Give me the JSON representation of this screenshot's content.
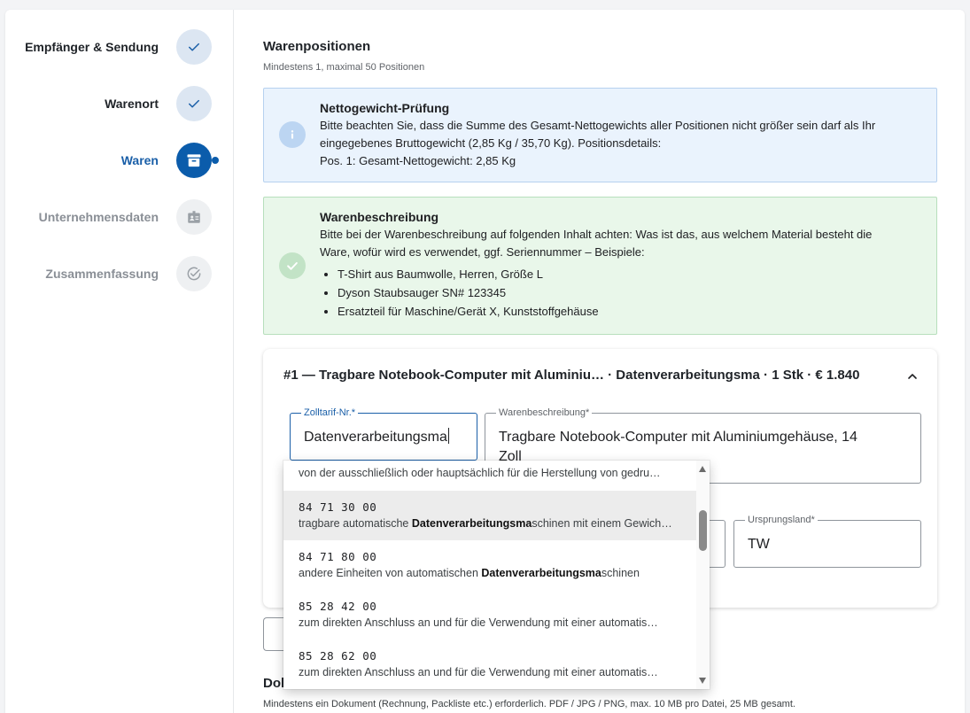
{
  "sidebar": {
    "steps": [
      {
        "label": "Empfänger & Sendung",
        "state": "done",
        "icon": "check-icon"
      },
      {
        "label": "Warenort",
        "state": "done",
        "icon": "check-icon"
      },
      {
        "label": "Waren",
        "state": "active",
        "icon": "archive-box-icon"
      },
      {
        "label": "Unternehmensdaten",
        "state": "pending",
        "icon": "business-badge-icon"
      },
      {
        "label": "Zusammenfassung",
        "state": "pending",
        "icon": "check-circle-icon"
      }
    ]
  },
  "main": {
    "title": "Warenpositionen",
    "subtitle": "Mindestens 1, maximal 50 Positionen",
    "info_alert": {
      "title": "Nettogewicht-Prüfung",
      "line1": "Bitte beachten Sie, dass die Summe des Gesamt-Nettogewichts aller Positionen nicht größer sein darf als Ihr",
      "line2": "eingegebenes Bruttogewicht (2,85 Kg / 35,70 Kg). Positionsdetails:",
      "line3": "Pos. 1: Gesamt-Nettogewicht: 2,85 Kg"
    },
    "ok_alert": {
      "title": "Warenbeschreibung",
      "line1": "Bitte bei der Warenbeschreibung auf folgenden Inhalt achten: Was ist das, aus welchem Material besteht die",
      "line2": "Ware, wofür wird es verwendet, ggf. Seriennummer – Beispiele:",
      "examples": [
        "T-Shirt aus Baumwolle, Herren, Größe L",
        "Dyson Staubsauger SN# 123345",
        "Ersatzteil für Maschine/Gerät X, Kunststoffgehäuse"
      ]
    },
    "item": {
      "header": "#1 — Tragbare Notebook-Computer mit Aluminiu… · Datenverarbeitungsma · 1 Stk · € 1.840",
      "tariff_label": "Zolltarif-Nr.*",
      "tariff_value": "Datenverarbeitungsma",
      "desc_label": "Warenbeschreibung*",
      "desc_value_line1": "Tragbare Notebook-Computer mit Aluminiumgehäuse, 14",
      "desc_value_line2": "Zoll",
      "origin_label": "Ursprungsland*",
      "origin_value": "TW"
    },
    "documents": {
      "title": "Dok",
      "subtitle": "Mindestens ein Dokument (Rechnung, Packliste etc.) erforderlich. PDF / JPG / PNG, max. 10 MB pro Datei, 25 MB gesamt."
    }
  },
  "dropdown": {
    "partial_desc": "von der ausschließlich oder hauptsächlich für die Herstellung von gedru…",
    "options": [
      {
        "code": "84 71 30 00",
        "pre": "tragbare automatische ",
        "match": "Datenverarbeitungsma",
        "post": "schinen mit einem Gewich…",
        "highlighted": true
      },
      {
        "code": "84 71 80 00",
        "pre": "andere Einheiten von automatischen ",
        "match": "Datenverarbeitungsma",
        "post": "schinen",
        "highlighted": false
      },
      {
        "code": "85 28 42 00",
        "pre": "zum direkten Anschluss an und für die Verwendung mit einer automatis…",
        "match": "",
        "post": "",
        "highlighted": false
      },
      {
        "code": "85 28 62 00",
        "pre": "zum direkten Anschluss an und für die Verwendung mit einer automatis…",
        "match": "",
        "post": "",
        "highlighted": false
      }
    ]
  },
  "colors": {
    "primary": "#0b5cab",
    "info_bg": "#eaf3fd",
    "success_bg": "#e9f7ea"
  }
}
